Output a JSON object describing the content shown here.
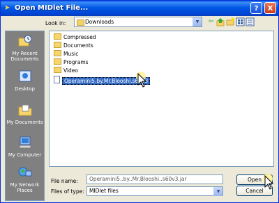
{
  "window": {
    "title": "Open MIDlet File...",
    "help_label": "?",
    "close_label": "X"
  },
  "toolbar": {
    "lookin_label": "Look in:",
    "lookin_value": "Downloads"
  },
  "places": [
    {
      "label": "My Recent Documents"
    },
    {
      "label": "Desktop"
    },
    {
      "label": "My Documents"
    },
    {
      "label": "My Computer"
    },
    {
      "label": "My Network Places"
    }
  ],
  "files": [
    {
      "name": "Compressed",
      "type": "folder"
    },
    {
      "name": "Documents",
      "type": "folder"
    },
    {
      "name": "Music",
      "type": "folder"
    },
    {
      "name": "Programs",
      "type": "folder"
    },
    {
      "name": "Video",
      "type": "folder"
    },
    {
      "name": "Operamini5.by.Mr.Blooshi.s60v3",
      "type": "file",
      "selected": true
    }
  ],
  "footer": {
    "file_name_label": "File name:",
    "file_name_value": "Operamini5..by..Mr.Blooshi..s60v3.jar",
    "file_type_label": "Files of type:",
    "file_type_value": "MIDlet files",
    "open_label": "Open",
    "cancel_label": "Cancel"
  }
}
